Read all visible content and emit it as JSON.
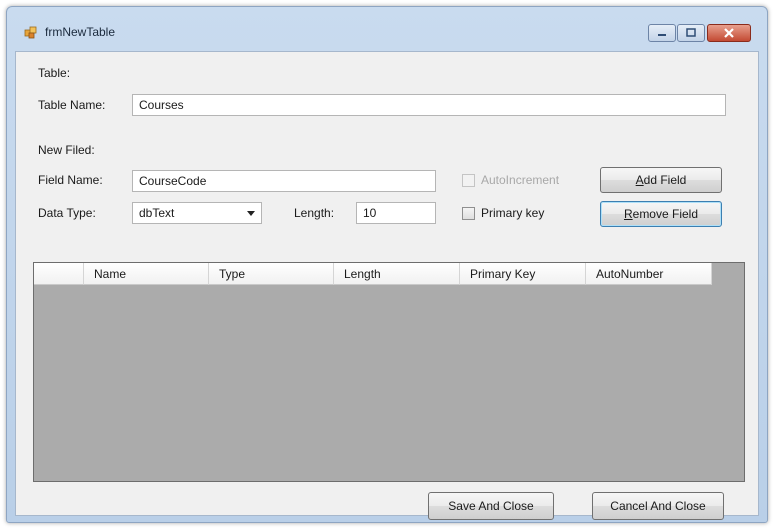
{
  "window": {
    "title": "frmNewTable"
  },
  "table_section": {
    "group_label": "Table:",
    "name_label": "Table Name:",
    "name_value": "Courses"
  },
  "field_section": {
    "group_label": "New Filed:",
    "field_name_label": "Field Name:",
    "field_name_value": "CourseCode",
    "data_type_label": "Data Type:",
    "data_type_value": "dbText",
    "length_label": "Length:",
    "length_value": "10",
    "auto_increment_label": "AutoIncrement",
    "auto_increment_checked": false,
    "auto_increment_enabled": false,
    "primary_key_label": "Primary key",
    "primary_key_checked": false
  },
  "buttons": {
    "add_field_accel": "A",
    "add_field_rest": "dd Field",
    "remove_field_accel": "R",
    "remove_field_rest": "emove Field",
    "save_and_close": "Save And Close",
    "cancel_and_close": "Cancel And Close"
  },
  "grid": {
    "columns": [
      "Name",
      "Type",
      "Length",
      "Primary Key",
      "AutoNumber"
    ],
    "rows": []
  },
  "colors": {
    "frame": "#b9cfe8",
    "client": "#f0f0f0",
    "grid_background": "#ababab",
    "close_button": "#c34a33"
  }
}
